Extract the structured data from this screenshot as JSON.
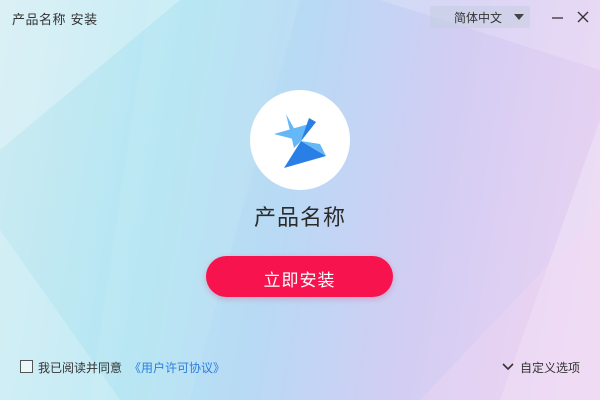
{
  "window": {
    "title": "产品名称 安装",
    "minimize_icon": "minimize-icon",
    "close_icon": "close-icon"
  },
  "language_select": {
    "value": "简体中文",
    "icon": "caret-down-icon"
  },
  "main": {
    "logo_icon": "pinwheel-logo-icon",
    "product_name": "产品名称",
    "install_button": "立即安装"
  },
  "footer": {
    "agree_checked": false,
    "agree_text": "我已阅读并同意",
    "license_link": "《用户许可协议》",
    "custom_options": "自定义选项",
    "custom_icon": "chevron-down-icon"
  },
  "colors": {
    "accent": "#f7134d",
    "link": "#2a7de0",
    "logo_light": "#64b8f5",
    "logo_dark": "#2a7fe6"
  }
}
